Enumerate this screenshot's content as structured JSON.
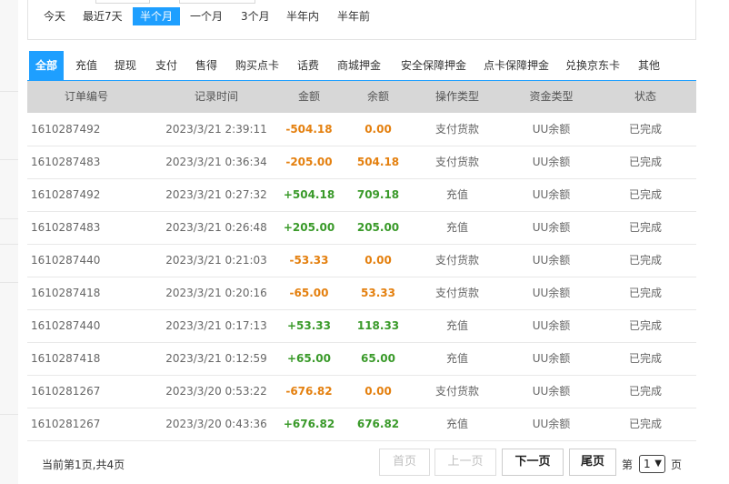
{
  "ranges": [
    "今天",
    "最近7天",
    "半个月",
    "一个月",
    "3个月",
    "半年内",
    "半年前"
  ],
  "tabs": [
    "全部",
    "充值",
    "提现",
    "支付",
    "售得",
    "购买点卡",
    "话费",
    "商城押金",
    "安全保障押金",
    "点卡保障押金",
    "兑换京东卡",
    "其他"
  ],
  "columns": [
    "订单编号",
    "记录时间",
    "金额",
    "余额",
    "操作类型",
    "资金类型",
    "状态"
  ],
  "rows": [
    {
      "order": "1610287492",
      "time": "2023/3/21 2:39:11",
      "amount": "-504.18",
      "balance": "0.00",
      "op": "支付货款",
      "fund": "UU余额",
      "status": "已完成"
    },
    {
      "order": "1610287483",
      "time": "2023/3/21 0:36:34",
      "amount": "-205.00",
      "balance": "504.18",
      "op": "支付货款",
      "fund": "UU余额",
      "status": "已完成"
    },
    {
      "order": "1610287492",
      "time": "2023/3/21 0:27:32",
      "amount": "+504.18",
      "balance": "709.18",
      "op": "充值",
      "fund": "UU余额",
      "status": "已完成"
    },
    {
      "order": "1610287483",
      "time": "2023/3/21 0:26:48",
      "amount": "+205.00",
      "balance": "205.00",
      "op": "充值",
      "fund": "UU余额",
      "status": "已完成"
    },
    {
      "order": "1610287440",
      "time": "2023/3/21 0:21:03",
      "amount": "-53.33",
      "balance": "0.00",
      "op": "支付货款",
      "fund": "UU余额",
      "status": "已完成"
    },
    {
      "order": "1610287418",
      "time": "2023/3/21 0:20:16",
      "amount": "-65.00",
      "balance": "53.33",
      "op": "支付货款",
      "fund": "UU余额",
      "status": "已完成"
    },
    {
      "order": "1610287440",
      "time": "2023/3/21 0:17:13",
      "amount": "+53.33",
      "balance": "118.33",
      "op": "充值",
      "fund": "UU余额",
      "status": "已完成"
    },
    {
      "order": "1610287418",
      "time": "2023/3/21 0:12:59",
      "amount": "+65.00",
      "balance": "65.00",
      "op": "充值",
      "fund": "UU余额",
      "status": "已完成"
    },
    {
      "order": "1610281267",
      "time": "2023/3/20 0:53:22",
      "amount": "-676.82",
      "balance": "0.00",
      "op": "支付货款",
      "fund": "UU余额",
      "status": "已完成"
    },
    {
      "order": "1610281267",
      "time": "2023/3/20 0:43:36",
      "amount": "+676.82",
      "balance": "676.82",
      "op": "充值",
      "fund": "UU余额",
      "status": "已完成"
    }
  ],
  "pagination": {
    "info": "当前第1页,共4页",
    "first": "首页",
    "prev": "上一页",
    "next": "下一页",
    "last": "尾页",
    "jump_label": "第",
    "jump_suffix": "页",
    "selected_page": "1"
  },
  "colors": {
    "accent": "#1e9fff",
    "negative": "#e4800f",
    "positive": "#3a9a2a",
    "header_bg": "#d7d7d7"
  }
}
